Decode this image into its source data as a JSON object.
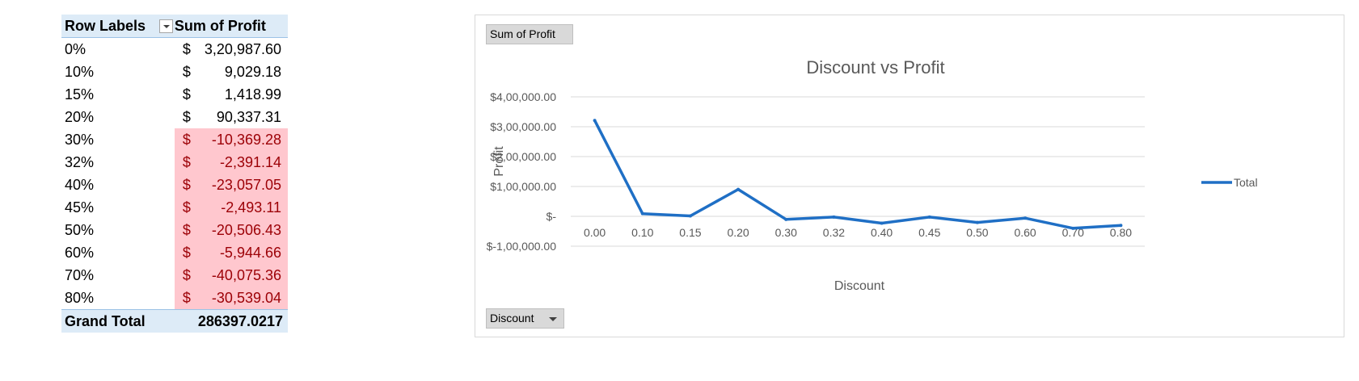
{
  "pivot": {
    "header": {
      "row_labels": "Row Labels",
      "sum_profit": "Sum of Profit"
    },
    "rows": [
      {
        "label": "0%",
        "currency": "$",
        "value": "3,20,987.60",
        "negative": false
      },
      {
        "label": "10%",
        "currency": "$",
        "value": "9,029.18",
        "negative": false
      },
      {
        "label": "15%",
        "currency": "$",
        "value": "1,418.99",
        "negative": false
      },
      {
        "label": "20%",
        "currency": "$",
        "value": "90,337.31",
        "negative": false
      },
      {
        "label": "30%",
        "currency": "$",
        "value": "-10,369.28",
        "negative": true
      },
      {
        "label": "32%",
        "currency": "$",
        "value": "-2,391.14",
        "negative": true
      },
      {
        "label": "40%",
        "currency": "$",
        "value": "-23,057.05",
        "negative": true
      },
      {
        "label": "45%",
        "currency": "$",
        "value": "-2,493.11",
        "negative": true
      },
      {
        "label": "50%",
        "currency": "$",
        "value": "-20,506.43",
        "negative": true
      },
      {
        "label": "60%",
        "currency": "$",
        "value": "-5,944.66",
        "negative": true
      },
      {
        "label": "70%",
        "currency": "$",
        "value": "-40,075.36",
        "negative": true
      },
      {
        "label": "80%",
        "currency": "$",
        "value": "-30,539.04",
        "negative": true
      }
    ],
    "grand_total": {
      "label": "Grand Total",
      "value": "286397.0217"
    }
  },
  "chart_buttons": {
    "value_field": "Sum of Profit",
    "axis_field": "Discount"
  },
  "chart_data": {
    "type": "line",
    "title": "Discount vs Profit",
    "xlabel": "Discount",
    "ylabel": "Profit",
    "categories": [
      "0.00",
      "0.10",
      "0.15",
      "0.20",
      "0.30",
      "0.32",
      "0.40",
      "0.45",
      "0.50",
      "0.60",
      "0.70",
      "0.80"
    ],
    "series": [
      {
        "name": "Total",
        "color": "#1f6fc5",
        "values": [
          320987.6,
          9029.18,
          1418.99,
          90337.31,
          -10369.28,
          -2391.14,
          -23057.05,
          -2493.11,
          -20506.43,
          -5944.66,
          -40075.36,
          -30539.04
        ]
      }
    ],
    "ylim": [
      -100000,
      400000
    ],
    "yticks": [
      400000,
      300000,
      200000,
      100000,
      0,
      -100000
    ],
    "ytick_labels": [
      "$4,00,000.00",
      "$3,00,000.00",
      "$2,00,000.00",
      "$1,00,000.00",
      "$-",
      "$-1,00,000.00"
    ],
    "grid": true,
    "legend_position": "right"
  }
}
